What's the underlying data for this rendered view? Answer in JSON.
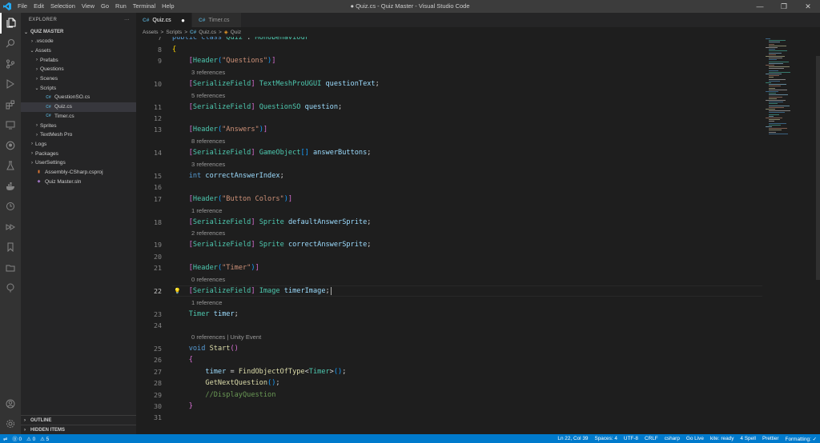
{
  "window": {
    "title": "● Quiz.cs - Quiz Master - Visual Studio Code",
    "menu": [
      "File",
      "Edit",
      "Selection",
      "View",
      "Go",
      "Run",
      "Terminal",
      "Help"
    ],
    "controls": [
      "—",
      "❐",
      "✕"
    ]
  },
  "sidebar": {
    "header": "EXPLORER",
    "more": "···",
    "project": "QUIZ MASTER",
    "items": [
      {
        "label": ".vscode",
        "depth": 1,
        "kind": "folder",
        "open": false
      },
      {
        "label": "Assets",
        "depth": 1,
        "kind": "folder",
        "open": true
      },
      {
        "label": "Prefabs",
        "depth": 2,
        "kind": "folder",
        "open": false
      },
      {
        "label": "Questions",
        "depth": 2,
        "kind": "folder",
        "open": false
      },
      {
        "label": "Scenes",
        "depth": 2,
        "kind": "folder",
        "open": false
      },
      {
        "label": "Scripts",
        "depth": 2,
        "kind": "folder",
        "open": true
      },
      {
        "label": "QuestionSO.cs",
        "depth": 3,
        "kind": "cs"
      },
      {
        "label": "Quiz.cs",
        "depth": 3,
        "kind": "cs",
        "selected": true
      },
      {
        "label": "Timer.cs",
        "depth": 3,
        "kind": "cs"
      },
      {
        "label": "Sprites",
        "depth": 2,
        "kind": "folder",
        "open": false
      },
      {
        "label": "TextMesh Pro",
        "depth": 2,
        "kind": "folder",
        "open": false
      },
      {
        "label": "Logs",
        "depth": 1,
        "kind": "folder",
        "open": false
      },
      {
        "label": "Packages",
        "depth": 1,
        "kind": "folder",
        "open": false
      },
      {
        "label": "UserSettings",
        "depth": 1,
        "kind": "folder",
        "open": false
      },
      {
        "label": "Assembly-CSharp.csproj",
        "depth": 1,
        "kind": "proj"
      },
      {
        "label": "Quiz Master.sln",
        "depth": 1,
        "kind": "sln"
      }
    ],
    "outline": "OUTLINE",
    "hidden_items": "HIDDEN ITEMS"
  },
  "tabs": [
    {
      "label": "Quiz.cs",
      "active": true,
      "dirty": true
    },
    {
      "label": "Timer.cs",
      "active": false,
      "dirty": false
    }
  ],
  "breadcrumb": {
    "parts": [
      "Assets",
      ">",
      "Scripts",
      ">",
      "Quiz.cs",
      ">",
      "Quiz"
    ]
  },
  "editor": {
    "current_line": 22,
    "lines": [
      {
        "n": 7,
        "partial": true,
        "tokens": [
          [
            "kw",
            "public"
          ],
          [
            "punc",
            " "
          ],
          [
            "kw",
            "class"
          ],
          [
            "punc",
            " "
          ],
          [
            "ty",
            "Quiz"
          ],
          [
            "punc",
            " : "
          ],
          [
            "ty",
            "MonoBehaviour"
          ]
        ]
      },
      {
        "n": 8,
        "tokens": [
          [
            "br1",
            "{"
          ]
        ]
      },
      {
        "n": 9,
        "tokens": [
          [
            "punc",
            "    "
          ],
          [
            "br2",
            "["
          ],
          [
            "ty",
            "Header"
          ],
          [
            "br3",
            "("
          ],
          [
            "str",
            "\"Questions\""
          ],
          [
            "br3",
            ")"
          ],
          [
            "br2",
            "]"
          ]
        ]
      },
      {
        "lens": "3 references"
      },
      {
        "n": 10,
        "tokens": [
          [
            "punc",
            "    "
          ],
          [
            "br2",
            "["
          ],
          [
            "ty",
            "SerializeField"
          ],
          [
            "br2",
            "]"
          ],
          [
            "punc",
            " "
          ],
          [
            "ty",
            "TextMeshProUGUI"
          ],
          [
            "punc",
            " "
          ],
          [
            "var",
            "questionText"
          ],
          [
            "punc",
            ";"
          ]
        ]
      },
      {
        "lens": "5 references"
      },
      {
        "n": 11,
        "tokens": [
          [
            "punc",
            "    "
          ],
          [
            "br2",
            "["
          ],
          [
            "ty",
            "SerializeField"
          ],
          [
            "br2",
            "]"
          ],
          [
            "punc",
            " "
          ],
          [
            "ty",
            "QuestionSO"
          ],
          [
            "punc",
            " "
          ],
          [
            "var",
            "question"
          ],
          [
            "punc",
            ";"
          ]
        ]
      },
      {
        "n": 12,
        "tokens": []
      },
      {
        "n": 13,
        "tokens": [
          [
            "punc",
            "    "
          ],
          [
            "br2",
            "["
          ],
          [
            "ty",
            "Header"
          ],
          [
            "br3",
            "("
          ],
          [
            "str",
            "\"Answers\""
          ],
          [
            "br3",
            ")"
          ],
          [
            "br2",
            "]"
          ]
        ]
      },
      {
        "lens": "8 references"
      },
      {
        "n": 14,
        "tokens": [
          [
            "punc",
            "    "
          ],
          [
            "br2",
            "["
          ],
          [
            "ty",
            "SerializeField"
          ],
          [
            "br2",
            "]"
          ],
          [
            "punc",
            " "
          ],
          [
            "ty",
            "GameObject"
          ],
          [
            "br3",
            "[]"
          ],
          [
            "punc",
            " "
          ],
          [
            "var",
            "answerButtons"
          ],
          [
            "punc",
            ";"
          ]
        ]
      },
      {
        "lens": "3 references"
      },
      {
        "n": 15,
        "tokens": [
          [
            "punc",
            "    "
          ],
          [
            "kw",
            "int"
          ],
          [
            "punc",
            " "
          ],
          [
            "var",
            "correctAnswerIndex"
          ],
          [
            "punc",
            ";"
          ]
        ]
      },
      {
        "n": 16,
        "tokens": []
      },
      {
        "n": 17,
        "tokens": [
          [
            "punc",
            "    "
          ],
          [
            "br2",
            "["
          ],
          [
            "ty",
            "Header"
          ],
          [
            "br3",
            "("
          ],
          [
            "str",
            "\"Button Colors\""
          ],
          [
            "br3",
            ")"
          ],
          [
            "br2",
            "]"
          ]
        ]
      },
      {
        "lens": "1 reference"
      },
      {
        "n": 18,
        "tokens": [
          [
            "punc",
            "    "
          ],
          [
            "br2",
            "["
          ],
          [
            "ty",
            "SerializeField"
          ],
          [
            "br2",
            "]"
          ],
          [
            "punc",
            " "
          ],
          [
            "ty",
            "Sprite"
          ],
          [
            "punc",
            " "
          ],
          [
            "var",
            "defaultAnswerSprite"
          ],
          [
            "punc",
            ";"
          ]
        ]
      },
      {
        "lens": "2 references"
      },
      {
        "n": 19,
        "tokens": [
          [
            "punc",
            "    "
          ],
          [
            "br2",
            "["
          ],
          [
            "ty",
            "SerializeField"
          ],
          [
            "br2",
            "]"
          ],
          [
            "punc",
            " "
          ],
          [
            "ty",
            "Sprite"
          ],
          [
            "punc",
            " "
          ],
          [
            "var",
            "correctAnswerSprite"
          ],
          [
            "punc",
            ";"
          ]
        ]
      },
      {
        "n": 20,
        "tokens": []
      },
      {
        "n": 21,
        "tokens": [
          [
            "punc",
            "    "
          ],
          [
            "br2",
            "["
          ],
          [
            "ty",
            "Header"
          ],
          [
            "br3",
            "("
          ],
          [
            "str",
            "\"Timer\""
          ],
          [
            "br3",
            ")"
          ],
          [
            "br2",
            "]"
          ]
        ]
      },
      {
        "lens": "0 references"
      },
      {
        "n": 22,
        "tokens": [
          [
            "punc",
            "    "
          ],
          [
            "br2",
            "["
          ],
          [
            "ty",
            "SerializeField"
          ],
          [
            "br2",
            "]"
          ],
          [
            "punc",
            " "
          ],
          [
            "ty",
            "Image"
          ],
          [
            "punc",
            " "
          ],
          [
            "var",
            "timerImage"
          ],
          [
            "punc",
            ";"
          ]
        ]
      },
      {
        "lens": "1 reference"
      },
      {
        "n": 23,
        "tokens": [
          [
            "punc",
            "    "
          ],
          [
            "ty",
            "Timer"
          ],
          [
            "punc",
            " "
          ],
          [
            "var",
            "timer"
          ],
          [
            "punc",
            ";"
          ]
        ]
      },
      {
        "n": 24,
        "tokens": []
      },
      {
        "lens": "0 references | Unity Event"
      },
      {
        "n": 25,
        "tokens": [
          [
            "punc",
            "    "
          ],
          [
            "kw",
            "void"
          ],
          [
            "punc",
            " "
          ],
          [
            "fn",
            "Start"
          ],
          [
            "br2",
            "()"
          ]
        ]
      },
      {
        "n": 26,
        "tokens": [
          [
            "punc",
            "    "
          ],
          [
            "br2",
            "{"
          ]
        ]
      },
      {
        "n": 27,
        "tokens": [
          [
            "punc",
            "        "
          ],
          [
            "var",
            "timer"
          ],
          [
            "punc",
            " = "
          ],
          [
            "fn",
            "FindObjectOfType"
          ],
          [
            "punc",
            "<"
          ],
          [
            "ty",
            "Timer"
          ],
          [
            "punc",
            ">"
          ],
          [
            "br3",
            "()"
          ],
          [
            "punc",
            ";"
          ]
        ]
      },
      {
        "n": 28,
        "tokens": [
          [
            "punc",
            "        "
          ],
          [
            "fn",
            "GetNextQuestion"
          ],
          [
            "br3",
            "()"
          ],
          [
            "punc",
            ";"
          ]
        ]
      },
      {
        "n": 29,
        "tokens": [
          [
            "punc",
            "        "
          ],
          [
            "cm",
            "//DisplayQuestion"
          ]
        ]
      },
      {
        "n": 30,
        "tokens": [
          [
            "punc",
            "    "
          ],
          [
            "br2",
            "}"
          ]
        ]
      },
      {
        "n": 31,
        "tokens": []
      }
    ]
  },
  "status": {
    "left": [
      "⓪ 0",
      "⚠ 0",
      "⚠ 5"
    ],
    "right": [
      "Ln 22, Col 39",
      "Spaces: 4",
      "UTF-8",
      "CRLF",
      "csharp",
      "Go Live",
      "kite: ready",
      "4 Spell",
      "Prettier",
      "Formatting: ✓"
    ]
  },
  "colors": {
    "status_bg": "#007acc",
    "editor_bg": "#1e1e1e",
    "sidebar_bg": "#252526"
  }
}
